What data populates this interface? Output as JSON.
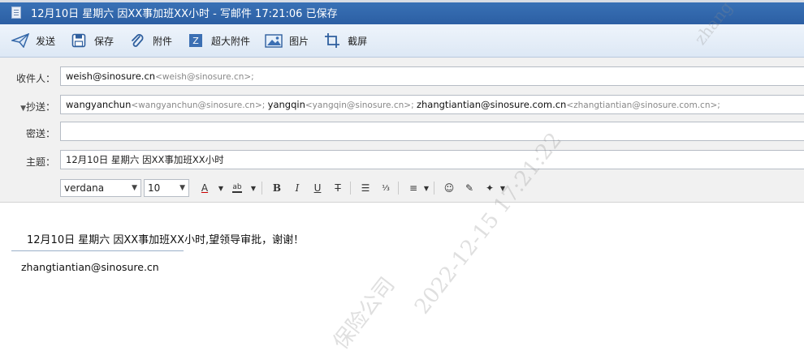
{
  "window": {
    "title": "12月10日 星期六 因XX事加班XX小时 - 写邮件   17:21:06 已保存"
  },
  "toolbar": {
    "send": "发送",
    "save": "保存",
    "attach": "附件",
    "big_attach": "超大附件",
    "image": "图片",
    "screenshot": "截屏"
  },
  "fields": {
    "to_label": "收件人：",
    "cc_label": "抄送：",
    "bcc_label": "密送：",
    "subject_label": "主题：",
    "to": [
      {
        "name": "weish@sinosure.cn",
        "mail": "<weish@sinosure.cn>;"
      }
    ],
    "cc": [
      {
        "name": "wangyanchun",
        "mail": "<wangyanchun@sinosure.cn>; "
      },
      {
        "name": "yangqin",
        "mail": "<yangqin@sinosure.cn>; "
      },
      {
        "name": "zhangtiantian@sinosure.com.cn",
        "mail": "<zhangtiantian@sinosure.com.cn>;"
      }
    ],
    "bcc": "",
    "subject": "12月10日 星期六 因XX事加班XX小时"
  },
  "format": {
    "font": "verdana",
    "size": "10"
  },
  "body": {
    "text": "12月10日 星期六 因XX事加班XX小时,望领导审批，谢谢！",
    "signature": "zhangtiantian@sinosure.cn"
  },
  "watermark": {
    "datetime": "2022-12-15 17:21:22",
    "company": "保险公司",
    "top_fragment": "zhang"
  }
}
